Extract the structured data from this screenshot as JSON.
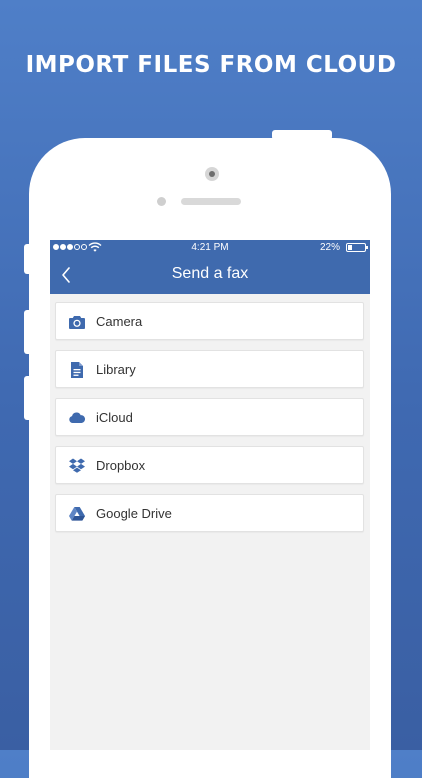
{
  "headline": "IMPORT FILES FROM CLOUD",
  "status_bar": {
    "time": "4:21 PM",
    "battery": "22%"
  },
  "nav": {
    "title": "Send a fax",
    "back_icon": "chevron-left-icon"
  },
  "sources": [
    {
      "label": "Camera",
      "icon": "camera-icon"
    },
    {
      "label": "Library",
      "icon": "document-icon"
    },
    {
      "label": "iCloud",
      "icon": "cloud-icon"
    },
    {
      "label": "Dropbox",
      "icon": "dropbox-icon"
    },
    {
      "label": "Google Drive",
      "icon": "google-drive-icon"
    }
  ],
  "colors": {
    "background": "#4a76c0",
    "nav_bar": "#3f6aae",
    "icon": "#3f6aae",
    "screen": "#f2f2f2"
  }
}
